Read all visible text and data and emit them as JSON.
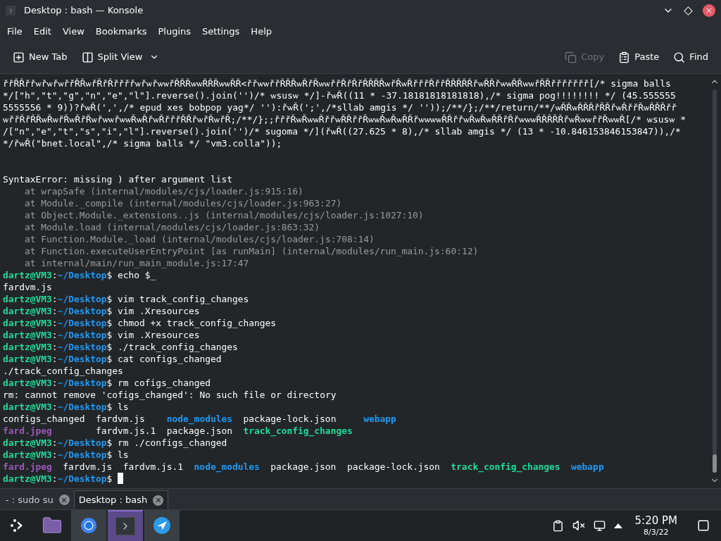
{
  "window": {
    "title": "Desktop : bash — Konsole"
  },
  "menu": [
    "File",
    "Edit",
    "View",
    "Bookmarks",
    "Plugins",
    "Settings",
    "Help"
  ],
  "toolbar": [
    {
      "label": "New Tab",
      "disabled": false
    },
    {
      "label": "Split View",
      "disabled": false
    },
    {
      "label": "Copy",
      "disabled": true
    },
    {
      "label": "Paste",
      "disabled": false
    },
    {
      "label": "Find",
      "disabled": false
    }
  ],
  "terminal": {
    "lines": [
      {
        "kind": "text",
        "text": "řřŘŘřřѡřѡřѡřřŘŘѡřŘřŘřřřřѡřѡřѡѡřŘŘŘѡѡŘŘŘѡѡŘŘ<řřѡѡřřŘŘŘѡŘřŘѡѡřřŘřŘřŘŘŘŘѡřŘѡŘřřřŘřřŘŘŘŘŘřѡŘŘřѡѡŘŘѡѡřŘŘřřřřřřř[/* sigma balls"
      },
      {
        "kind": "text",
        "text": "*/[\"h\",\"t\",\"g\",\"n\",\"e\",\"l\"].reverse().join('')/* ѡsusѡ */]-řѡŘ((11 * -37.18181818181818),/* sigma pog!!!!!!!! */ (45.555555"
      },
      {
        "kind": "text",
        "text": "5555556 * 9))?řѡŘ(',',/* epud xes bobpop yag*/ ''):řѡŘ(';',/*sllab amgis */ ''));/**/};/**/return/**/ѡŘŘѡŘŘŘřŘŘřѡŘřřŘѡŘŘŘřř"
      },
      {
        "kind": "text",
        "text": "ѡřřŘřŘŘѡŘѡřŘѡŘřŘѡřѡѡřѡѡŘѡŘřѡŘřřřŘŘřѡřŘѡřŘ;/**/};;řřřŘѡŘѡѡŘřřѡŘŘřřŘѡѡŘѡŘѡŘŘřѡѡѡѡŘŘřřѡŘѡŘѡŘŘřŘřѡѡѡŘŘŘŘŘřѡŘѡѡřřŘѡѡŘ[/* ѡsusѡ *"
      },
      {
        "kind": "text",
        "text": "/[\"n\",\"e\",\"t\",\"s\",\"i\",\"l\"].reverse().join('')/* sugoma */](řѡŘ((27.625 * 8),/* sllab amgis */ (13 * -10.846153846153847)),/*"
      },
      {
        "kind": "text",
        "text": "*/řѡŘ(\"bnet.local\",/* sigma balls */ \"vm3.colla\"));"
      },
      {
        "kind": "blank"
      },
      {
        "kind": "blank"
      },
      {
        "kind": "text",
        "text": "SyntaxError: missing ) after argument list"
      },
      {
        "kind": "trace",
        "text": "at wrapSafe (internal/modules/cjs/loader.js:915:16)"
      },
      {
        "kind": "trace",
        "text": "at Module._compile (internal/modules/cjs/loader.js:963:27)"
      },
      {
        "kind": "trace",
        "text": "at Object.Module._extensions..js (internal/modules/cjs/loader.js:1027:10)"
      },
      {
        "kind": "trace",
        "text": "at Module.load (internal/modules/cjs/loader.js:863:32)"
      },
      {
        "kind": "trace",
        "text": "at Function.Module._load (internal/modules/cjs/loader.js:708:14)"
      },
      {
        "kind": "trace",
        "text": "at Function.executeUserEntryPoint [as runMain] (internal/modules/run_main.js:60:12)"
      },
      {
        "kind": "trace",
        "text": "at internal/main/run_main_module.js:17:47"
      },
      {
        "kind": "prompt",
        "user": "dartz@VM3",
        "sep": ":",
        "path": "~/Desktop",
        "symbol": "$",
        "command": "echo $_"
      },
      {
        "kind": "text",
        "text": "fardvm.js"
      },
      {
        "kind": "prompt",
        "user": "dartz@VM3",
        "sep": ":",
        "path": "~/Desktop",
        "symbol": "$",
        "command": "vim track_config_changes"
      },
      {
        "kind": "prompt",
        "user": "dartz@VM3",
        "sep": ":",
        "path": "~/Desktop",
        "symbol": "$",
        "command": "vim .Xresources"
      },
      {
        "kind": "prompt",
        "user": "dartz@VM3",
        "sep": ":",
        "path": "~/Desktop",
        "symbol": "$",
        "command": "chmod +x track_config_changes"
      },
      {
        "kind": "prompt",
        "user": "dartz@VM3",
        "sep": ":",
        "path": "~/Desktop",
        "symbol": "$",
        "command": "vim .Xresources"
      },
      {
        "kind": "prompt",
        "user": "dartz@VM3",
        "sep": ":",
        "path": "~/Desktop",
        "symbol": "$",
        "command": "./track_config_changes"
      },
      {
        "kind": "prompt",
        "user": "dartz@VM3",
        "sep": ":",
        "path": "~/Desktop",
        "symbol": "$",
        "command": "cat configs_changed"
      },
      {
        "kind": "text",
        "text": "./track_config_changes"
      },
      {
        "kind": "prompt",
        "user": "dartz@VM3",
        "sep": ":",
        "path": "~/Desktop",
        "symbol": "$",
        "command": "rm cofigs_changed"
      },
      {
        "kind": "text",
        "text": "rm: cannot remove 'cofigs_changed': No such file or directory"
      },
      {
        "kind": "prompt",
        "user": "dartz@VM3",
        "sep": ":",
        "path": "~/Desktop",
        "symbol": "$",
        "command": "ls"
      },
      {
        "kind": "listing",
        "rows": [
          [
            {
              "name": "configs_changed",
              "kind": "file"
            },
            {
              "name": "fardvm.js",
              "kind": "file"
            },
            {
              "name": "node_modules",
              "kind": "dir"
            },
            {
              "name": "package-lock.json",
              "kind": "file"
            },
            {
              "name": "webapp",
              "kind": "dir"
            }
          ],
          [
            {
              "name": "fard.jpeg",
              "kind": "image"
            },
            {
              "name": "fardvm.js.1",
              "kind": "file"
            },
            {
              "name": "package.json",
              "kind": "file"
            },
            {
              "name": "track_config_changes",
              "kind": "exec"
            }
          ]
        ]
      },
      {
        "kind": "prompt",
        "user": "dartz@VM3",
        "sep": ":",
        "path": "~/Desktop",
        "symbol": "$",
        "command": "rm ./configs_changed"
      },
      {
        "kind": "prompt",
        "user": "dartz@VM3",
        "sep": ":",
        "path": "~/Desktop",
        "symbol": "$",
        "command": "ls"
      },
      {
        "kind": "listing",
        "rows": [
          [
            {
              "name": "fard.jpeg",
              "kind": "image"
            },
            {
              "name": "fardvm.js",
              "kind": "file"
            },
            {
              "name": "fardvm.js.1",
              "kind": "file"
            },
            {
              "name": "node_modules",
              "kind": "dir"
            },
            {
              "name": "package.json",
              "kind": "file"
            },
            {
              "name": "package-lock.json",
              "kind": "file"
            },
            {
              "name": "track_config_changes",
              "kind": "exec"
            },
            {
              "name": "webapp",
              "kind": "dir"
            }
          ]
        ]
      },
      {
        "kind": "prompt",
        "user": "dartz@VM3",
        "sep": ":",
        "path": "~/Desktop",
        "symbol": "$",
        "cursor": true
      }
    ]
  },
  "tabs": [
    {
      "label": "- : sudo su",
      "selected": false
    },
    {
      "label": "Desktop : bash",
      "selected": true
    }
  ],
  "taskbar": {
    "apps": [
      {
        "selected": false
      },
      {
        "selected": false
      },
      {
        "selected": true
      },
      {
        "selected": false
      }
    ],
    "time": "5:20 PM",
    "date": "8/3/22"
  }
}
